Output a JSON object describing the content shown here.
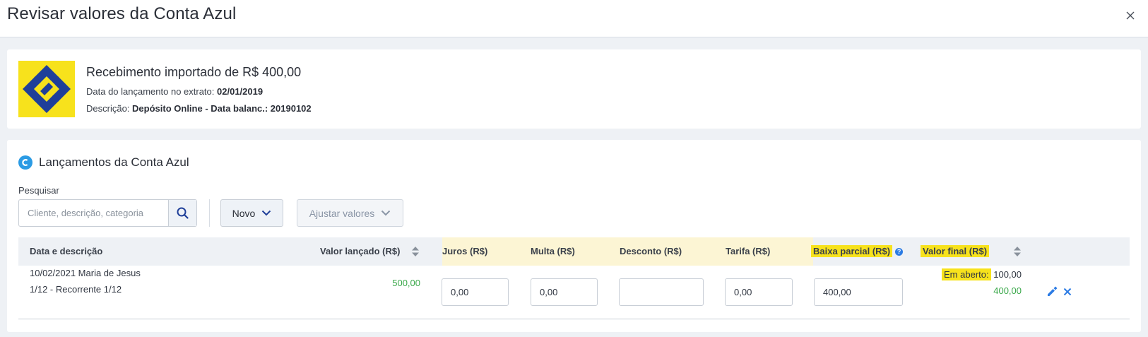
{
  "modal": {
    "title": "Revisar valores da Conta Azul"
  },
  "import": {
    "title": "Recebimento importado de R$ 400,00",
    "date_label": "Data do lançamento no extrato:",
    "date_value": "02/01/2019",
    "desc_label": "Descrição:",
    "desc_value": "Depósito Online - Data balanc.: 20190102"
  },
  "section": {
    "title": "Lançamentos da Conta Azul"
  },
  "search": {
    "label": "Pesquisar",
    "placeholder": "Cliente, descrição, categoria"
  },
  "toolbar": {
    "novo_label": "Novo",
    "ajustar_label": "Ajustar valores"
  },
  "table": {
    "headers": {
      "data_descricao": "Data e descrição",
      "valor_lancado": "Valor lançado (R$)",
      "juros": "Juros (R$)",
      "multa": "Multa (R$)",
      "desconto": "Desconto (R$)",
      "tarifa": "Tarifa (R$)",
      "baixa_parcial": "Baixa parcial (R$)",
      "valor_final": "Valor final (R$)"
    },
    "rows": [
      {
        "date_name": "10/02/2021 Maria de Jesus",
        "recurrence": "1/12 - Recorrente 1/12",
        "valor_lancado": "500,00",
        "juros": "0,00",
        "multa": "0,00",
        "desconto": "",
        "tarifa": "0,00",
        "baixa_parcial": "400,00",
        "em_aberto_label": "Em aberto:",
        "em_aberto_value": "100,00",
        "valor_final": "400,00"
      }
    ]
  },
  "colors": {
    "accent_yellow": "#f7e21c",
    "accent_blue": "#2b7be4",
    "value_green": "#3aa84a"
  },
  "icons": {
    "close": "close-icon",
    "search": "search-icon",
    "chevron": "chevron-down-icon",
    "sort": "sort-icon",
    "info": "info-icon",
    "edit": "pencil-icon",
    "remove": "remove-icon",
    "section": "conta-azul-logo-icon",
    "bank": "banco-do-brasil-logo"
  }
}
